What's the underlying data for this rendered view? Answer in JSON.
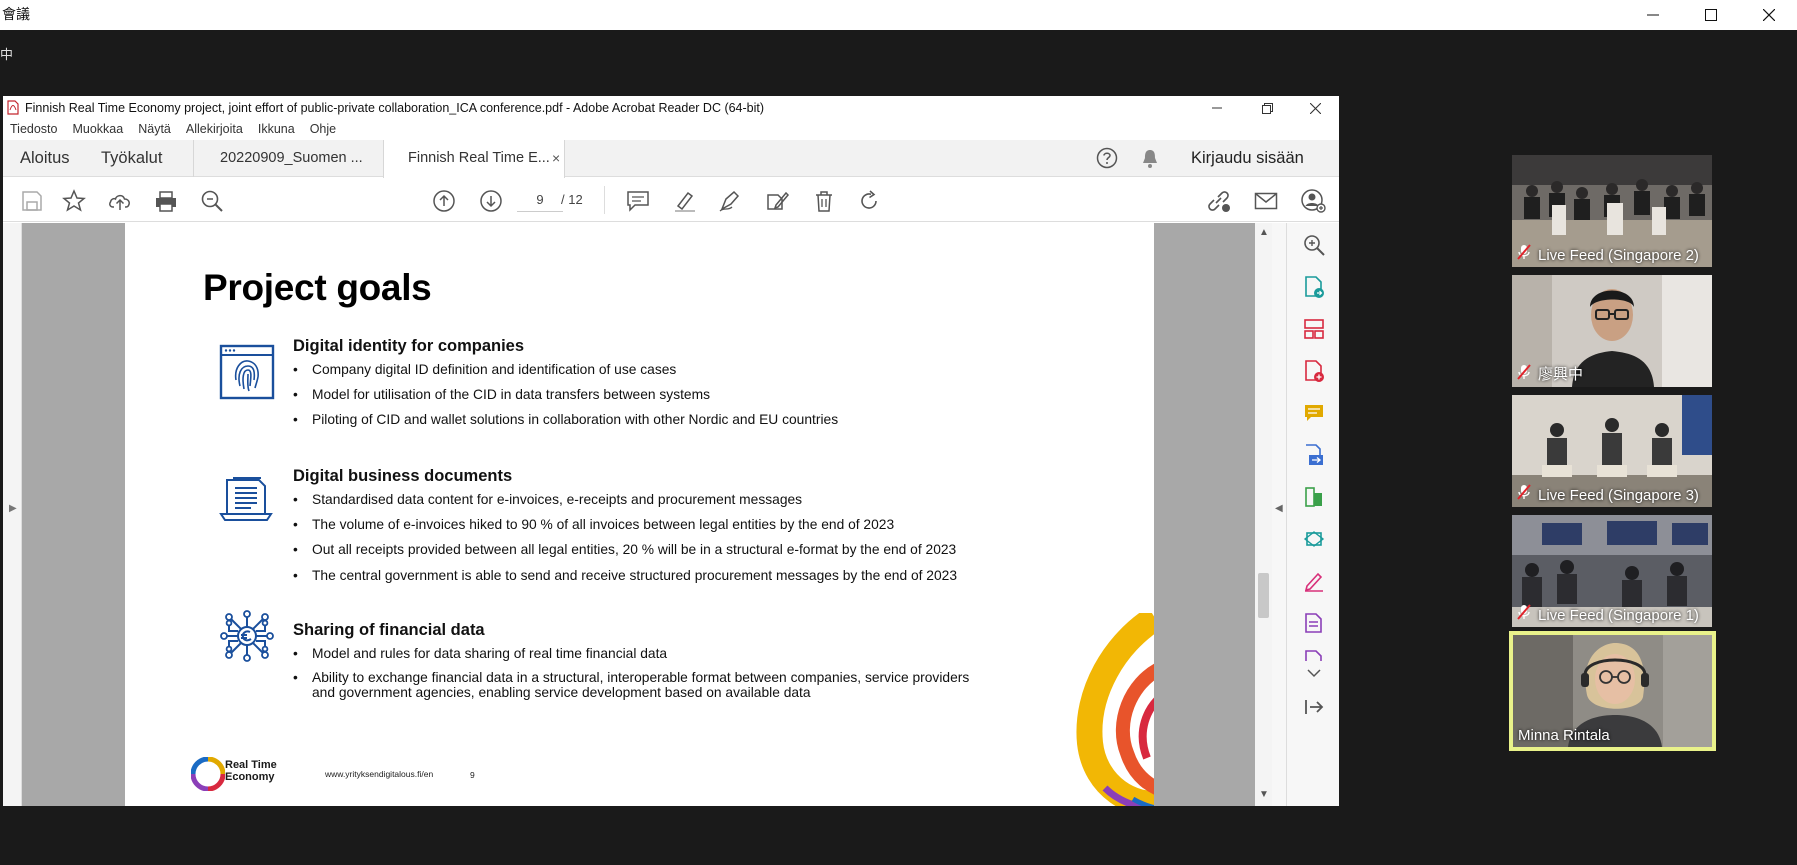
{
  "zoom_window": {
    "title": "會議",
    "share_indicator": "中",
    "controls": {
      "minimize": "—",
      "maximize": "☐",
      "close": "✕"
    }
  },
  "acrobat": {
    "title": "Finnish Real Time Economy project, joint effort of public-private collaboration_ICA conference.pdf - Adobe Acrobat Reader DC (64-bit)",
    "menu": [
      "Tiedosto",
      "Muokkaa",
      "Näytä",
      "Allekirjoita",
      "Ikkuna",
      "Ohje"
    ],
    "main_tabs": {
      "home": "Aloitus",
      "tools": "Työkalut"
    },
    "doc_tabs": [
      "20220909_Suomen ...",
      "Finnish Real Time E..."
    ],
    "doc_tab_close": "×",
    "sign_in": "Kirjaudu sisään",
    "toolbar": {
      "icons": [
        "save-icon",
        "bookmark-star-icon",
        "upload-icon",
        "print-icon",
        "zoom-search-icon",
        "page-up-icon",
        "page-down-icon",
        "comment-icon",
        "highlight-icon",
        "draw-icon",
        "edit-stamp-icon",
        "delete-icon",
        "rotate-icon",
        "share-link-icon",
        "email-icon",
        "user-share-icon"
      ],
      "page_current": "9",
      "page_total": "/ 12"
    },
    "right_pane_icons": [
      "zoom-icon",
      "export-pdf-icon",
      "organize-pages-icon",
      "create-pdf-icon",
      "comment-icon",
      "combine-files-icon",
      "compress-icon",
      "send-icon",
      "fill-sign-icon",
      "protect-icon",
      "more-tools-icon",
      "chevron-down-icon",
      "collapse-pane-icon"
    ],
    "colors": {
      "accent_blue": "#1a4f9c",
      "tool_red": "#d8293f",
      "tool_purple": "#8b3fb8",
      "tool_teal": "#1a9b9b",
      "tool_yellow": "#e1a900"
    }
  },
  "slide": {
    "title": "Project goals",
    "sections": [
      {
        "title": "Digital identity for companies",
        "icon": "fingerprint-icon",
        "bullets": [
          "Company digital ID definition and identification of use cases",
          "Model for utilisation of the CID in data transfers between systems",
          "Piloting of CID and wallet solutions in collaboration with other Nordic and EU countries"
        ]
      },
      {
        "title": "Digital business documents",
        "icon": "document-laptop-icon",
        "bullets": [
          "Standardised data content for e-invoices, e-receipts and procurement messages",
          "The volume of e-invoices hiked to 90 % of all invoices between legal entities by the end of 2023",
          "Out all receipts provided between all legal entities, 20 % will be in a structural e-format by the end of 2023",
          "The central government is able to send and receive structured procurement messages by the end of 2023"
        ]
      },
      {
        "title": "Sharing of financial data",
        "icon": "euro-network-icon",
        "bullets": [
          "Model and rules for data sharing of real time financial data",
          "Ability to exchange financial data in a structural, interoperable format between companies, service providers and government agencies, enabling service development based on available data"
        ]
      }
    ],
    "footer": {
      "logo_text_1": "Real Time",
      "logo_text_2": "Economy",
      "url": "www.yrityksendigitalous.fi/en",
      "page": "9"
    }
  },
  "participants": [
    {
      "name": "Live Feed (Singapore 2)",
      "muted": true
    },
    {
      "name": "廖興中",
      "muted": true
    },
    {
      "name": "Live Feed (Singapore 3)",
      "muted": true
    },
    {
      "name": "Live Feed (Singapore 1)",
      "muted": true
    },
    {
      "name": "Minna Rintala",
      "muted": false,
      "active_speaker": true
    }
  ]
}
